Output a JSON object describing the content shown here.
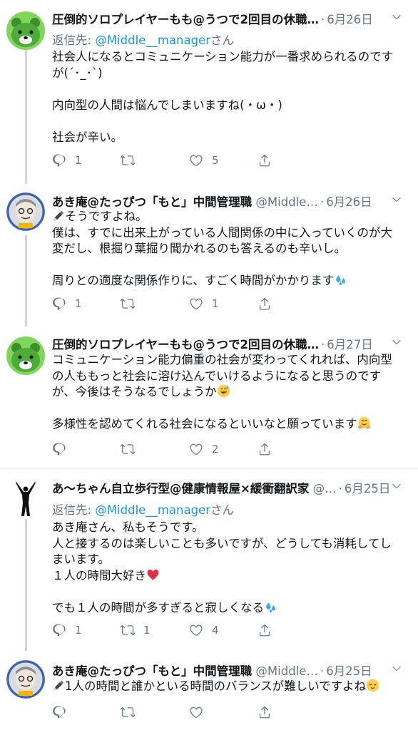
{
  "tweets": [
    {
      "name": "圧倒的ソロプレイヤーもも@うつで2回目の休職…",
      "handle": "",
      "date": "6月26日",
      "reply_prefix": "返信先:",
      "reply_mention": "@Middle__manager",
      "reply_suffix": "さん",
      "lines": [
        "社会人になるとコミュニケーション能力が一番求められるのです",
        "が(´･_･`)",
        "",
        "内向型の人間は悩んでしまいますね(・ω・)",
        "",
        "社会が辛い。"
      ],
      "replies": "1",
      "retweets": "",
      "likes": "5"
    },
    {
      "name": "あき庵@たっぴつ「もと」中間管理職",
      "handle": "@Middle…",
      "date": "6月26日",
      "lines": [
        "そうですよね。",
        "僕は、すでに出来上がっている人間関係の中に入っていくのが大",
        "変だし、根掘り葉掘り聞かれるのも答えるのも辛いし。",
        "",
        "周りとの適度な関係作りに、すごく時間がかかります"
      ],
      "replies": "1",
      "retweets": "",
      "likes": "1"
    },
    {
      "name": "圧倒的ソロプレイヤーもも@うつで2回目の休職…",
      "handle": "",
      "date": "6月27日",
      "lines": [
        "コミュニケーション能力偏重の社会が変わってくれれば、内向型",
        "の人ももっと社会に溶け込んでいけるようになると思うのです",
        "が、今後はそうなるでしょうか",
        "",
        "多様性を認めてくれる社会になるといいなと願っています"
      ],
      "replies": "",
      "retweets": "",
      "likes": "2"
    },
    {
      "name": "あ〜ちゃん自立歩行型@健康情報屋×緩衝翻訳家",
      "handle": "@…",
      "date": "6月25日",
      "reply_prefix": "返信先:",
      "reply_mention": "@Middle__manager",
      "reply_suffix": "さん",
      "lines": [
        "あき庵さん、私もそうです。",
        "人と接するのは楽しいことも多いですが、どうしても消耗してし",
        "まいます。",
        "１人の時間大好き",
        "",
        "でも１人の時間が多すぎると寂しくなる"
      ],
      "replies": "1",
      "retweets": "1",
      "likes": "4"
    },
    {
      "name": "あき庵@たっぴつ「もと」中間管理職",
      "handle": "@Middle…",
      "date": "6月25日",
      "lines": [
        "1人の時間と誰かといる時間のバランスが難しいですよね"
      ],
      "replies": "",
      "retweets": "",
      "likes": ""
    }
  ],
  "colors": {
    "muted": "#657786",
    "link": "#1b95e0",
    "thread": "#ccd6dd",
    "heart": "#e0245e",
    "sweat": "#3ea6f2"
  },
  "icons": [
    "reply-icon",
    "retweet-icon",
    "like-icon",
    "share-icon",
    "caret-down-icon",
    "pen-icon"
  ]
}
